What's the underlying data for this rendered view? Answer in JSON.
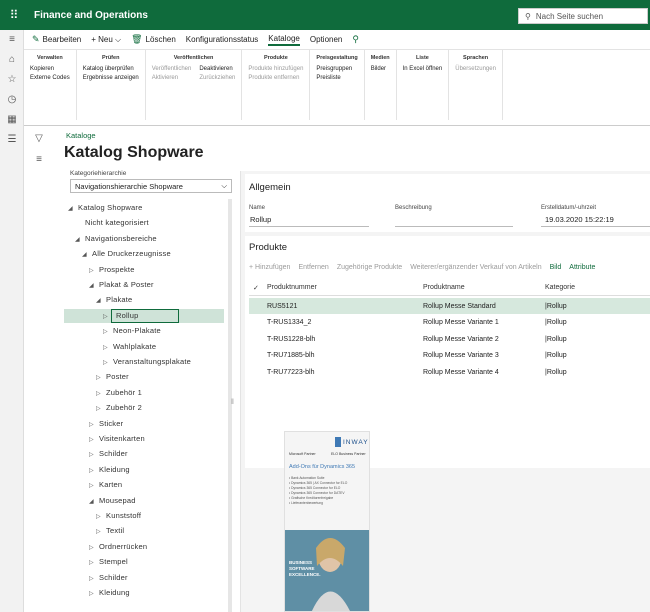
{
  "app": {
    "title": "Finance and Operations",
    "search_placeholder": "Nach Seite suchen"
  },
  "actionbar": {
    "items": [
      {
        "label": "Bearbeiten",
        "icon": "pencil-icon"
      },
      {
        "label": "+ Neu ⌵",
        "icon": ""
      },
      {
        "label": "Löschen",
        "icon": "trash-icon"
      },
      {
        "label": "Konfigurationsstatus",
        "icon": ""
      },
      {
        "label": "Kataloge",
        "icon": "",
        "selected": true
      },
      {
        "label": "Optionen",
        "icon": ""
      },
      {
        "label": "",
        "icon": "search-icon"
      }
    ]
  },
  "ribbon": {
    "groups": [
      {
        "title": "Verwalten",
        "cols": [
          [
            {
              "t": "Kopieren",
              "d": false
            },
            {
              "t": "Externe Codes",
              "d": false
            }
          ]
        ]
      },
      {
        "title": "Prüfen",
        "cols": [
          [
            {
              "t": "Katalog überprüfen",
              "d": false
            },
            {
              "t": "Ergebnisse anzeigen",
              "d": false
            }
          ]
        ]
      },
      {
        "title": "Veröffentlichen",
        "cols": [
          [
            {
              "t": "Veröffentlichen",
              "d": true
            },
            {
              "t": "Aktivieren",
              "d": true
            }
          ],
          [
            {
              "t": "Deaktivieren",
              "d": false
            },
            {
              "t": "Zurückziehen",
              "d": true
            }
          ]
        ]
      },
      {
        "title": "Produkte",
        "cols": [
          [
            {
              "t": "Produkte hinzufügen",
              "d": true
            },
            {
              "t": "Produkte entfernen",
              "d": true
            }
          ]
        ]
      },
      {
        "title": "Preisgestaltung",
        "cols": [
          [
            {
              "t": "Preisgruppen",
              "d": false
            },
            {
              "t": "Preisliste",
              "d": false
            }
          ]
        ]
      },
      {
        "title": "Medien",
        "cols": [
          [
            {
              "t": "Bilder",
              "d": false
            }
          ]
        ]
      },
      {
        "title": "Liste",
        "cols": [
          [
            {
              "t": "In Excel öffnen",
              "d": false
            }
          ]
        ]
      },
      {
        "title": "Sprachen",
        "cols": [
          [
            {
              "t": "Übersetzungen",
              "d": true
            }
          ]
        ]
      }
    ]
  },
  "page": {
    "breadcrumb": "Kataloge",
    "title": "Katalog Shopware",
    "category_label": "Kategoriehierarchie",
    "category_value": "Navigationshierarchie Shopware"
  },
  "tree": [
    {
      "label": "Katalog Shopware",
      "level": 0,
      "arrow": "◢"
    },
    {
      "label": "Nicht kategorisiert",
      "level": 1,
      "arrow": ""
    },
    {
      "label": "Navigationsbereiche",
      "level": 1,
      "arrow": "◢"
    },
    {
      "label": "Alle Druckerzeugnisse",
      "level": 2,
      "arrow": "◢"
    },
    {
      "label": "Prospekte",
      "level": 3,
      "arrow": "▷"
    },
    {
      "label": "Plakat & Poster",
      "level": 3,
      "arrow": "◢"
    },
    {
      "label": "Plakate",
      "level": 4,
      "arrow": "◢"
    },
    {
      "label": "Rollup",
      "level": 5,
      "arrow": "▷",
      "selected": true
    },
    {
      "label": "Neon-Plakate",
      "level": 5,
      "arrow": "▷"
    },
    {
      "label": "Wahlplakate",
      "level": 5,
      "arrow": "▷"
    },
    {
      "label": "Veranstaltungsplakate",
      "level": 5,
      "arrow": "▷"
    },
    {
      "label": "Poster",
      "level": 4,
      "arrow": "▷"
    },
    {
      "label": "Zubehör 1",
      "level": 4,
      "arrow": "▷"
    },
    {
      "label": "Zubehör 2",
      "level": 4,
      "arrow": "▷"
    },
    {
      "label": "Sticker",
      "level": 3,
      "arrow": "▷"
    },
    {
      "label": "Visitenkarten",
      "level": 3,
      "arrow": "▷"
    },
    {
      "label": "Schilder",
      "level": 3,
      "arrow": "▷"
    },
    {
      "label": "Kleidung",
      "level": 3,
      "arrow": "▷"
    },
    {
      "label": "Karten",
      "level": 3,
      "arrow": "▷"
    },
    {
      "label": "Mousepad",
      "level": 3,
      "arrow": "◢"
    },
    {
      "label": "Kunststoff",
      "level": 4,
      "arrow": "▷"
    },
    {
      "label": "Textil",
      "level": 4,
      "arrow": "▷"
    },
    {
      "label": "Ordnerrücken",
      "level": 3,
      "arrow": "▷"
    },
    {
      "label": "Stempel",
      "level": 3,
      "arrow": "▷"
    },
    {
      "label": "Schilder",
      "level": 3,
      "arrow": "▷"
    },
    {
      "label": "Kleidung",
      "level": 3,
      "arrow": "▷"
    }
  ],
  "general": {
    "header": "Allgemein",
    "name_label": "Name",
    "name_value": "Rollup",
    "desc_label": "Beschreibung",
    "desc_value": "",
    "date_label": "Erstelldatum/-uhrzeit",
    "date_value": "19.03.2020 15:22:19"
  },
  "products": {
    "header": "Produkte",
    "toolbar": [
      {
        "t": "+ Hinzufügen",
        "d": true
      },
      {
        "t": "Entfernen",
        "d": true
      },
      {
        "t": "Zugehörige Produkte",
        "d": true
      },
      {
        "t": "Weiterer/ergänzender Verkauf von Artikeln",
        "d": true
      },
      {
        "t": "Bild",
        "d": false
      },
      {
        "t": "Attribute",
        "d": false
      }
    ],
    "columns": [
      "Produktnummer",
      "Produktname",
      "Kategorie"
    ],
    "rows": [
      {
        "num": "RUS5121",
        "name": "Rollup Messe Standard",
        "cat": "Rollup",
        "selected": true
      },
      {
        "num": "T-RUS1334_2",
        "name": "Rollup Messe Variante 1",
        "cat": "Rollup"
      },
      {
        "num": "T-RUS1228-blh",
        "name": "Rollup Messe Variante 2",
        "cat": "Rollup"
      },
      {
        "num": "T-RU71885-blh",
        "name": "Rollup Messe Variante 3",
        "cat": "Rollup"
      },
      {
        "num": "T-RU77223-blh",
        "name": "Rollup Messe Variante 4",
        "cat": "Rollup"
      }
    ]
  },
  "image": {
    "brand": "INWAY",
    "partner1": "Microsoft Partner",
    "partner2": "ELO Business Partner",
    "headline": "Add-Ons für Dynamics 365",
    "bullets": [
      "• Bank Automation Suite",
      "• Dynamics 365 | AX Connector for ELO",
      "• Dynamics 365 Connector for ELO",
      "• Dynamics 365 Connector for DATEV",
      "• Grafische Kreditorenfreigabe",
      "• Lieferantenbewertung"
    ],
    "tagline": [
      "BUSINESS",
      "SOFTWARE",
      "EXCELLENCE."
    ]
  }
}
